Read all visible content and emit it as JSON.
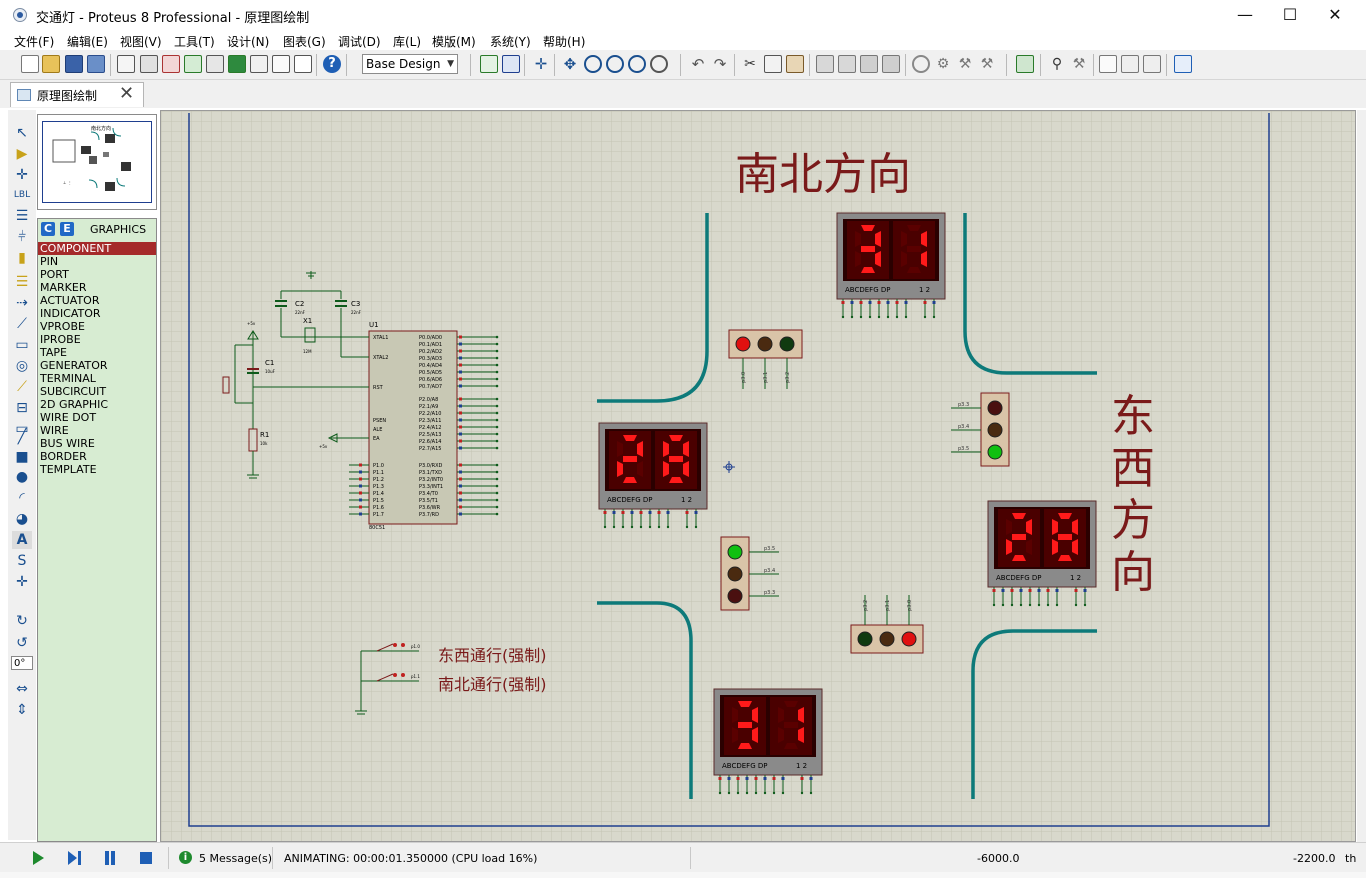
{
  "window": {
    "title": "交通灯 - Proteus 8 Professional - 原理图绘制",
    "minimize": "—",
    "maximize": "☐",
    "close": "✕"
  },
  "menu": [
    "文件(F)",
    "编辑(E)",
    "视图(V)",
    "工具(T)",
    "设计(N)",
    "图表(G)",
    "调试(D)",
    "库(L)",
    "模版(M)",
    "系统(Y)",
    "帮助(H)"
  ],
  "toolbar": {
    "design_select": "Base Design"
  },
  "tab": {
    "label": "原理图绘制",
    "close": "✕"
  },
  "tools": {
    "rotation_value": "0°"
  },
  "object_panel": {
    "c_label": "C",
    "e_label": "E",
    "title": "GRAPHICS",
    "items": [
      "COMPONENT",
      "PIN",
      "PORT",
      "MARKER",
      "ACTUATOR",
      "INDICATOR",
      "VPROBE",
      "IPROBE",
      "TAPE",
      "GENERATOR",
      "TERMINAL",
      "SUBCIRCUIT",
      "2D GRAPHIC",
      "WIRE DOT",
      "WIRE",
      "BUS WIRE",
      "BORDER",
      "TEMPLATE"
    ],
    "selected": "COMPONENT"
  },
  "schematic": {
    "labels": {
      "north_south": "南北方向",
      "east_west_1": "东",
      "east_west_2": "西",
      "east_west_3": "方",
      "east_west_4": "向",
      "force_ew": "东西通行(强制)",
      "force_ns": "南北通行(强制)"
    },
    "displays": {
      "north": "31",
      "west": "28",
      "east": "28",
      "south": "31",
      "segment_legend": "ABCDEFG DP",
      "digit_legend": "1 2"
    },
    "mcu": {
      "ref": "U1",
      "part": "80C51",
      "pins_left": [
        "XTAL1",
        "XTAL2",
        "RST",
        "PSEN",
        "ALE",
        "EA",
        "P1.0",
        "P1.1",
        "P1.2",
        "P1.3",
        "P1.4",
        "P1.5",
        "P1.6",
        "P1.7"
      ],
      "pins_right_p0": [
        "P0.0/AD0",
        "P0.1/AD1",
        "P0.2/AD2",
        "P0.3/AD3",
        "P0.4/AD4",
        "P0.5/AD5",
        "P0.6/AD6",
        "P0.7/AD7"
      ],
      "pins_right_p2": [
        "P2.0/A8",
        "P2.1/A9",
        "P2.2/A10",
        "P2.3/A11",
        "P2.4/A12",
        "P2.5/A13",
        "P2.6/A14",
        "P2.7/A15"
      ],
      "pins_right_p3": [
        "P3.0/RXD",
        "P3.1/TXD",
        "P3.2/INT0",
        "P3.3/INT1",
        "P3.4/T0",
        "P3.5/T1",
        "P3.6/WR",
        "P3.7/RD"
      ]
    },
    "parts": {
      "c1": "C1",
      "c1_val": "10uF",
      "c2": "C2",
      "c2_val": "22nF",
      "c3": "C3",
      "c3_val": "22nF",
      "x1": "X1",
      "x1_val": "12M",
      "r1": "R1",
      "r1_val": "10k",
      "vcc": "+5v",
      "sw1_net": "p1.0",
      "sw2_net": "p1.1"
    },
    "lights": {
      "north": {
        "red": "on",
        "yellow": "off",
        "green": "off"
      },
      "east": {
        "red": "off",
        "yellow": "off",
        "green": "on"
      },
      "west": {
        "red": "off",
        "yellow": "off",
        "green": "on"
      },
      "south": {
        "red": "on",
        "yellow": "off",
        "green": "off"
      },
      "nets_a": [
        "p3.0",
        "p3.1",
        "p3.2"
      ],
      "nets_b": [
        "p3.3",
        "p3.4",
        "p3.5"
      ]
    }
  },
  "status": {
    "messages": "5 Message(s)",
    "info_glyph": "i",
    "animating": "ANIMATING: 00:00:01.350000 (CPU load 16%)",
    "coord_x": "-6000.0",
    "coord_y": "-2200.0",
    "unit": "th"
  },
  "colors": {
    "canvas": "#d8d8cc",
    "grid": "#c4c4b4",
    "border": "#1f3f8f",
    "wire": "#0d7a7a",
    "road": "#0d7a7a",
    "label": "#7a1a1a",
    "display_bg": "#8a0000",
    "segment_on": "#ff1a1a",
    "panel": "#d7ecd2",
    "selected": "#a52a2a"
  }
}
